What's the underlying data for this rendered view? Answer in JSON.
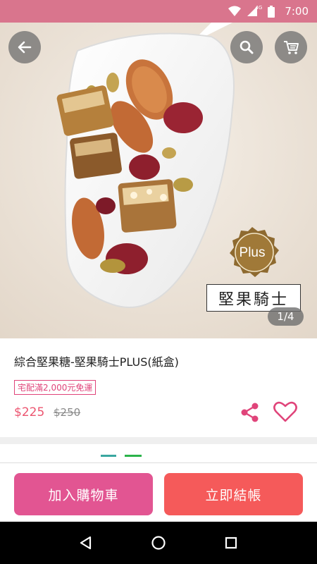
{
  "status_bar": {
    "time": "7:00",
    "network": "4G"
  },
  "hero": {
    "badge_text": "Plus",
    "product_card_title": "堅果騎士",
    "page_indicator": "1/4"
  },
  "product": {
    "name": "綜合堅果糖-堅果騎士PLUS(紙盒)",
    "shipping_badge": "宅配滿2,000元免運",
    "price": "$225",
    "original_price": "$250"
  },
  "actions": {
    "add_to_cart": "加入購物車",
    "checkout": "立即結帳"
  },
  "colors": {
    "status_bar": "#d9758d",
    "accent_pink": "#e25592",
    "accent_red": "#f55a5a",
    "price": "#ec5570"
  },
  "icons": {
    "back": "arrow-left-icon",
    "search": "search-icon",
    "cart": "cart-icon",
    "share": "share-icon",
    "favorite": "heart-icon",
    "nav_back": "triangle-back-icon",
    "nav_home": "circle-home-icon",
    "nav_recent": "square-recent-icon"
  }
}
